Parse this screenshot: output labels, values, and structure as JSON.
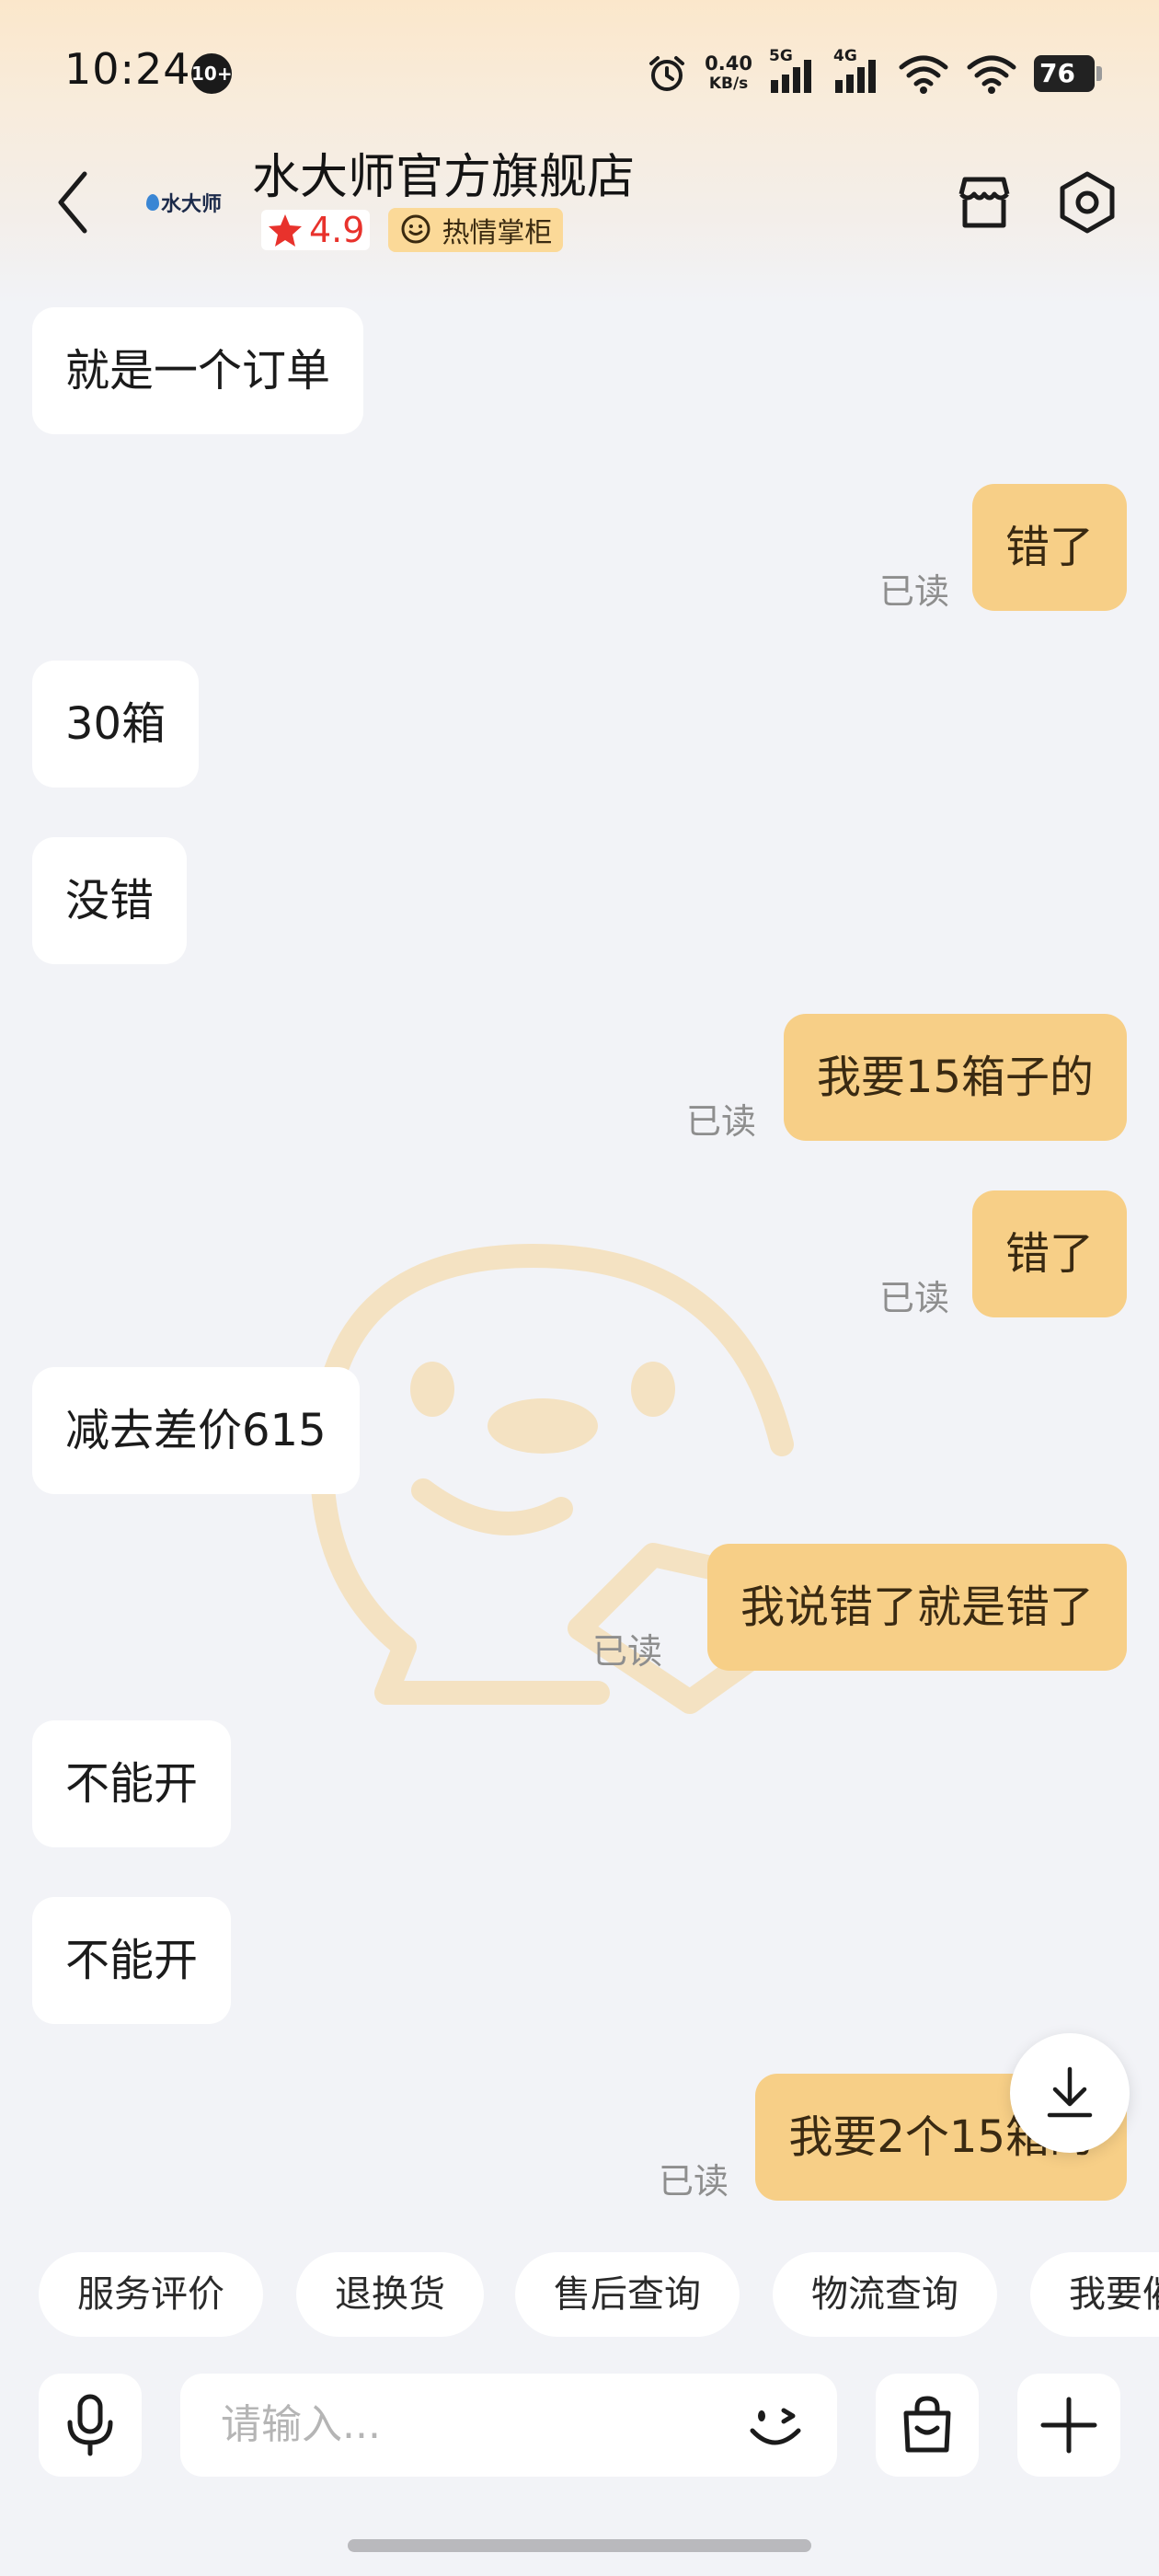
{
  "status_bar": {
    "time": "10:24",
    "notification_count": "10+",
    "net_speed_value": "0.40",
    "net_speed_unit": "KB/s",
    "signal1_gen": "5G",
    "signal2_gen": "4G",
    "battery": "76"
  },
  "header": {
    "logo_text": "水大师",
    "store_name": "水大师官方旗舰店",
    "rating": "4.9",
    "tag": "热情掌柜",
    "icons": [
      "back-icon",
      "store-icon",
      "settings-icon"
    ]
  },
  "messages": [
    {
      "dir": "in",
      "text": "就是一个订单"
    },
    {
      "dir": "out",
      "text": "错了",
      "status": "已读"
    },
    {
      "dir": "in",
      "text": "30箱"
    },
    {
      "dir": "in",
      "text": "没错"
    },
    {
      "dir": "out",
      "text": "我要15箱子的",
      "status": "已读"
    },
    {
      "dir": "out",
      "text": "错了",
      "status": "已读"
    },
    {
      "dir": "in",
      "text": "减去差价615"
    },
    {
      "dir": "out",
      "text": "我说错了就是错了",
      "status": "已读"
    },
    {
      "dir": "in",
      "text": "不能开"
    },
    {
      "dir": "in",
      "text": "不能开"
    },
    {
      "dir": "out",
      "text": "我要2个15箱的",
      "status": "已读"
    }
  ],
  "quick_replies": [
    "服务评价",
    "退换货",
    "售后查询",
    "物流查询",
    "我要催"
  ],
  "input": {
    "placeholder": "请输入...",
    "icons": [
      "mic-icon",
      "emoji-icon",
      "shopping-bag-icon",
      "plus-icon"
    ]
  },
  "colors": {
    "outgoing_bubble": "#f7cf87",
    "incoming_bubble": "#ffffff",
    "background": "#f2f3f7",
    "rating_red": "#e8322c"
  }
}
